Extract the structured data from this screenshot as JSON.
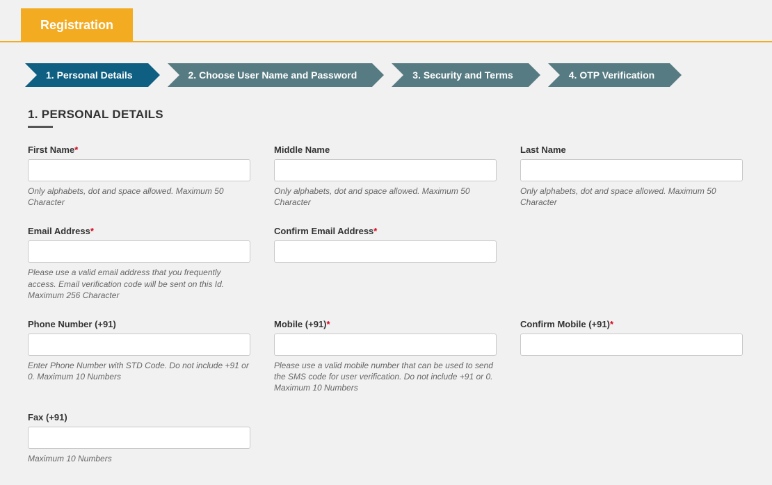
{
  "header": {
    "title": "Registration"
  },
  "steps": [
    {
      "label": "1. Personal Details",
      "active": true
    },
    {
      "label": "2. Choose User Name and Password",
      "active": false
    },
    {
      "label": "3. Security and Terms",
      "active": false
    },
    {
      "label": "4. OTP Verification",
      "active": false
    }
  ],
  "section": {
    "heading": "1. PERSONAL DETAILS"
  },
  "fields": {
    "first_name": {
      "label": "First Name",
      "required": true,
      "hint": "Only alphabets, dot and space allowed. Maximum 50 Character"
    },
    "middle_name": {
      "label": "Middle Name",
      "required": false,
      "hint": "Only alphabets, dot and space allowed. Maximum 50 Character"
    },
    "last_name": {
      "label": "Last Name",
      "required": false,
      "hint": "Only alphabets, dot and space allowed. Maximum 50 Character"
    },
    "email": {
      "label": "Email Address",
      "required": true,
      "hint": "Please use a valid email address that you frequently access. Email verification code will be sent on this Id. Maximum 256 Character"
    },
    "confirm_email": {
      "label": "Confirm Email Address",
      "required": true,
      "hint": ""
    },
    "phone": {
      "label": "Phone Number (+91)",
      "required": false,
      "hint": "Enter Phone Number with STD Code. Do not include +91 or 0. Maximum 10 Numbers"
    },
    "mobile": {
      "label": "Mobile (+91)",
      "required": true,
      "hint": "Please use a valid mobile number that can be used to send the SMS code for user verification. Do not include +91 or 0. Maximum 10 Numbers"
    },
    "confirm_mobile": {
      "label": "Confirm Mobile (+91)",
      "required": true,
      "hint": ""
    },
    "fax": {
      "label": "Fax (+91)",
      "required": false,
      "hint": "Maximum 10 Numbers"
    }
  },
  "asterisk": "*"
}
